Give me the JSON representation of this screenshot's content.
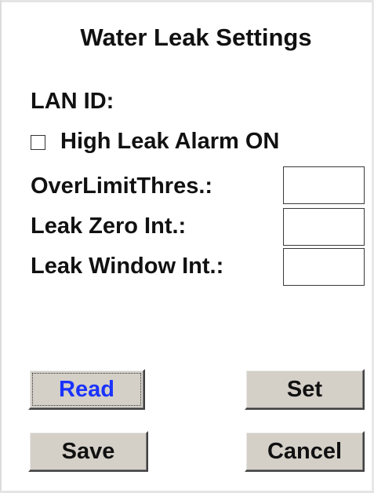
{
  "dialog": {
    "title": "Water Leak Settings"
  },
  "fields": {
    "lan_id_label": "LAN ID:",
    "lan_id_value": "",
    "high_leak_alarm_label": "High Leak Alarm ON",
    "high_leak_alarm_checked": false,
    "over_limit_label": "OverLimitThres.:",
    "over_limit_value": "",
    "leak_zero_label": "Leak Zero Int.:",
    "leak_zero_value": "",
    "leak_window_label": "Leak Window Int.:",
    "leak_window_value": ""
  },
  "buttons": {
    "read": "Read",
    "set": "Set",
    "save": "Save",
    "cancel": "Cancel"
  },
  "colors": {
    "button_face": "#d4d0c8",
    "read_text": "#1a33ff",
    "text": "#111111"
  }
}
